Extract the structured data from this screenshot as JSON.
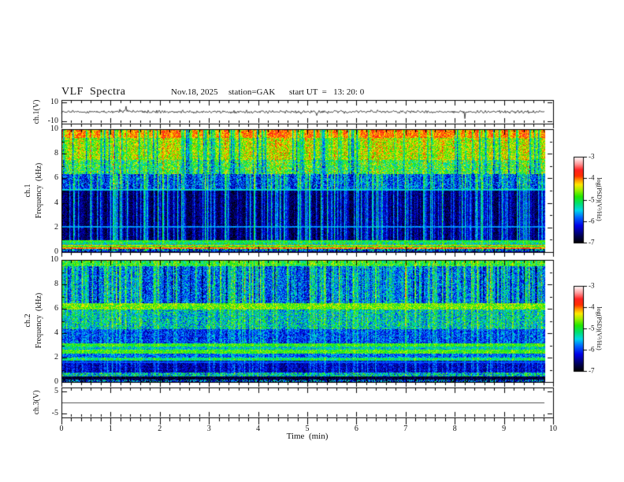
{
  "header": {
    "title": "VLF  Spectra",
    "date": "Nov.18, 2025",
    "station": "station=GAK",
    "start_ut": "start UT  =   13: 20: 0"
  },
  "x_axis": {
    "label": "Time  (min)",
    "min": 0,
    "max": 10,
    "major_ticks": [
      0,
      1,
      2,
      3,
      4,
      5,
      6,
      7,
      8,
      9,
      10
    ],
    "minor_step": 0.2
  },
  "panels": {
    "wave1": {
      "ylabel": "ch.1(V)",
      "ticks": [
        10,
        -10
      ],
      "vmin": -12.5,
      "vmax": 12.5
    },
    "spec1": {
      "channel": "ch.1",
      "ylabel": "Frequency  (kHz)",
      "major_ticks": [
        0,
        2,
        4,
        6,
        8,
        10
      ],
      "minor_ticks": [
        1,
        3,
        5,
        7,
        9
      ]
    },
    "spec2": {
      "channel": "ch.2",
      "ylabel": "Frequency  (kHz)",
      "major_ticks": [
        0,
        2,
        4,
        6,
        8,
        10
      ],
      "minor_ticks": [
        1,
        3,
        5,
        7,
        9
      ]
    },
    "wave3": {
      "ylabel": "ch.3(V)",
      "ticks": [
        5,
        -5
      ],
      "vmin": -6.9,
      "vmax": 6.9
    }
  },
  "colorbar": {
    "label": "log(PSD)(V²/Hz)",
    "ticks": [
      -3,
      -4,
      -5,
      -6,
      -7
    ],
    "max": -3,
    "min": -7,
    "stops": [
      [
        0.0,
        "#000000"
      ],
      [
        0.08,
        "#000050"
      ],
      [
        0.2,
        "#0000e8"
      ],
      [
        0.3,
        "#0068ff"
      ],
      [
        0.38,
        "#00d8e8"
      ],
      [
        0.46,
        "#00e070"
      ],
      [
        0.54,
        "#20e800"
      ],
      [
        0.62,
        "#a8f000"
      ],
      [
        0.68,
        "#ffe800"
      ],
      [
        0.73,
        "#ff9800"
      ],
      [
        0.78,
        "#ff3000"
      ],
      [
        0.85,
        "#ff2020"
      ],
      [
        0.92,
        "#ff9898"
      ],
      [
        1.0,
        "#ffffff"
      ]
    ]
  },
  "chart_data": [
    {
      "type": "line",
      "title": "ch.1 time series",
      "ylabel": "ch.1(V)",
      "xlabel": "Time  (min)",
      "xlim": [
        0,
        10
      ],
      "ylim": [
        -10,
        10
      ],
      "yticks": [
        10,
        -10
      ],
      "data_end_min": 9.83,
      "baseline_v": 0,
      "noise_sigma_v": 1.3,
      "spike_amplitude_v": 9,
      "description": "noisy black trace centered at 0 V with intermittent impulsive spikes up to about +/-9 V"
    },
    {
      "type": "heatmap",
      "title": "ch.1 VLF spectrogram",
      "ylabel": "ch.1 Frequency (kHz)",
      "xlabel": "Time  (min)",
      "xlim": [
        0,
        10
      ],
      "ylim": [
        0,
        10
      ],
      "zlabel": "log(PSD)(V²/Hz)",
      "zlim": [
        -7,
        -3
      ],
      "data_end_min": 9.83,
      "bands": [
        {
          "f": [
            0.0,
            0.1
          ],
          "psd": -6.5,
          "noise": 0.5,
          "streak": 0.3,
          "drop": 0
        },
        {
          "f": [
            0.1,
            0.32
          ],
          "psd": -5.9,
          "noise": 1.0,
          "streak": 0.4,
          "drop": 0
        },
        {
          "f": [
            0.32,
            0.44
          ],
          "psd": -4.05,
          "noise": 0.3,
          "streak": 0.1,
          "drop": 0
        },
        {
          "f": [
            0.44,
            0.54
          ],
          "psd": -4.9,
          "noise": 0.4,
          "streak": 0.2,
          "drop": 0
        },
        {
          "f": [
            0.54,
            0.64
          ],
          "psd": -4.2,
          "noise": 0.3,
          "streak": 0.1,
          "drop": 0
        },
        {
          "f": [
            0.64,
            0.8
          ],
          "psd": -5.3,
          "noise": 0.6,
          "streak": 0.3,
          "drop": 0
        },
        {
          "f": [
            0.8,
            0.92
          ],
          "psd": -5.1,
          "noise": 0.4,
          "streak": 0.3,
          "drop": 0
        },
        {
          "f": [
            0.92,
            1.0
          ],
          "psd": -4.9,
          "noise": 0.3,
          "streak": 0.2,
          "drop": 0
        },
        {
          "f": [
            1.0,
            5.15
          ],
          "psd": -6.75,
          "noise": 0.35,
          "streak": 1.7,
          "drop": 0
        },
        {
          "f": [
            5.15,
            6.4
          ],
          "psd": -6.15,
          "noise": 0.6,
          "streak": 1.5,
          "drop": 0
        },
        {
          "f": [
            6.4,
            7.6
          ],
          "psd": -5.0,
          "noise": 0.7,
          "streak": 0.6,
          "drop": 1.1
        },
        {
          "f": [
            7.6,
            9.4
          ],
          "psd": -4.55,
          "noise": 0.55,
          "streak": 0.4,
          "drop": 1.4
        },
        {
          "f": [
            9.4,
            10.01
          ],
          "psd": -4.05,
          "noise": 0.4,
          "streak": 0.3,
          "drop": 1.7
        }
      ],
      "tone_lines": [
        {
          "f": 2.08,
          "psd": -5.7
        },
        {
          "f": 5.15,
          "psd": -5.5
        }
      ],
      "description": "dark blue/black 1-5 kHz band cut by dense bright cyan vertical sferic streaks; green-yellow background above 6.5 kHz with red near 10 kHz and dark vertical dropouts; strong yellow narrowband lines below 1 kHz"
    },
    {
      "type": "heatmap",
      "title": "ch.2 VLF spectrogram",
      "ylabel": "ch.2 Frequency (kHz)",
      "xlabel": "Time  (min)",
      "xlim": [
        0,
        10
      ],
      "ylim": [
        0,
        10
      ],
      "zlabel": "log(PSD)(V²/Hz)",
      "zlim": [
        -7,
        -3
      ],
      "data_end_min": 9.83,
      "bands": [
        {
          "f": [
            0.0,
            0.25
          ],
          "psd": -6.2,
          "noise": 1.1,
          "streak": 0.3,
          "drop": 0
        },
        {
          "f": [
            0.25,
            0.5
          ],
          "psd": -6.85,
          "noise": 0.3,
          "streak": 0.2,
          "drop": 0
        },
        {
          "f": [
            0.5,
            0.8
          ],
          "psd": -5.5,
          "noise": 0.8,
          "streak": 0.4,
          "drop": 0
        },
        {
          "f": [
            0.8,
            1.8
          ],
          "psd": -6.45,
          "noise": 0.4,
          "streak": 0.8,
          "drop": 0
        },
        {
          "f": [
            1.8,
            2.05
          ],
          "psd": -5.25,
          "noise": 0.5,
          "streak": 0.4,
          "drop": 0
        },
        {
          "f": [
            2.05,
            2.4
          ],
          "psd": -5.95,
          "noise": 0.5,
          "streak": 0.5,
          "drop": 0
        },
        {
          "f": [
            2.4,
            2.7
          ],
          "psd": -4.9,
          "noise": 0.4,
          "streak": 0.3,
          "drop": 0
        },
        {
          "f": [
            2.7,
            2.95
          ],
          "psd": -5.5,
          "noise": 0.5,
          "streak": 0.4,
          "drop": 0
        },
        {
          "f": [
            2.95,
            3.2
          ],
          "psd": -4.95,
          "noise": 0.4,
          "streak": 0.3,
          "drop": 0
        },
        {
          "f": [
            3.2,
            4.4
          ],
          "psd": -6.1,
          "noise": 0.5,
          "streak": 0.8,
          "drop": 0
        },
        {
          "f": [
            4.4,
            6.0
          ],
          "psd": -5.55,
          "noise": 0.7,
          "streak": 0.8,
          "drop": 0
        },
        {
          "f": [
            6.0,
            6.5
          ],
          "psd": -4.75,
          "noise": 0.45,
          "streak": 0.3,
          "drop": 0
        },
        {
          "f": [
            6.5,
            9.6
          ],
          "psd": -5.9,
          "noise": 0.6,
          "streak": 1.5,
          "drop": 0.7
        },
        {
          "f": [
            9.6,
            10.01
          ],
          "psd": -5.05,
          "noise": 0.5,
          "streak": 0.6,
          "drop": 0
        }
      ],
      "tone_lines": [
        {
          "f": 1.65,
          "psd": -5.9
        }
      ],
      "description": "blue background with dense cyan/green vertical streaks above 6.5 kHz, bright green band at 6-6.5 kHz, green horizontal bands near 2.5 and 3 kHz, deep blue bands at 0.8-1.8 and 3.2-4.4 kHz"
    },
    {
      "type": "line",
      "title": "ch.3 time series",
      "ylabel": "ch.3(V)",
      "xlabel": "Time  (min)",
      "xlim": [
        0,
        10
      ],
      "ylim": [
        -5,
        5
      ],
      "yticks": [
        5,
        -5
      ],
      "data_end_min": 9.83,
      "constant_v": 0,
      "description": "flat gray line at 0 V"
    }
  ]
}
